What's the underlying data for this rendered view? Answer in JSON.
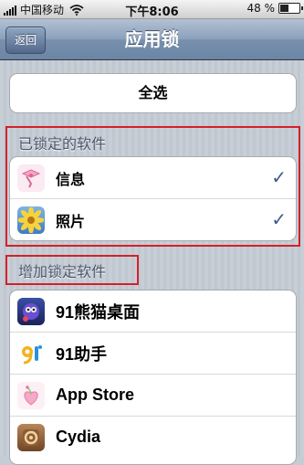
{
  "status_bar": {
    "carrier": "中国移动",
    "time": "下午8:06",
    "battery": "48 %"
  },
  "nav": {
    "back_label": "返回",
    "title": "应用锁"
  },
  "select_all": "全选",
  "locked_section": {
    "header": "已锁定的软件",
    "items": [
      {
        "label": "信息",
        "icon": "messages-icon",
        "checked": true
      },
      {
        "label": "照片",
        "icon": "photos-icon",
        "checked": true
      }
    ],
    "check_glyph": "✓"
  },
  "add_section": {
    "header": "增加锁定软件",
    "items": [
      {
        "label": "91熊猫桌面",
        "icon": "panda-desktop-icon"
      },
      {
        "label": "91助手",
        "icon": "91-assistant-icon"
      },
      {
        "label": "App Store",
        "icon": "app-store-icon"
      },
      {
        "label": "Cydia",
        "icon": "cydia-icon"
      }
    ]
  },
  "colors": {
    "highlight_border": "#d4202a",
    "nav_bar": "#7890ae",
    "check": "#3b5a8c"
  }
}
